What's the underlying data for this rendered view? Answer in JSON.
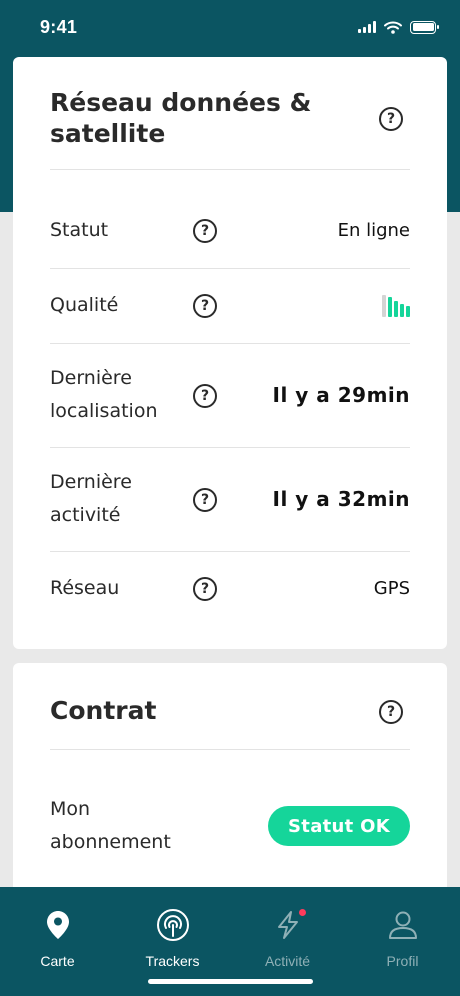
{
  "status_bar": {
    "time": "9:41"
  },
  "network_card": {
    "title": "Réseau données & satellite",
    "help_glyph": "?",
    "rows": [
      {
        "label": "Statut",
        "value": "En ligne"
      },
      {
        "label": "Qualité",
        "value": ""
      },
      {
        "label": "Dernière localisation",
        "value": "Il y a 29min"
      },
      {
        "label": "Dernière activité",
        "value": "Il y a 32min"
      },
      {
        "label": "Réseau",
        "value": "GPS"
      }
    ],
    "quality_level": 0.8,
    "quality_color": "#15d59a"
  },
  "contract_card": {
    "title": "Contrat",
    "subscription_label": "Mon abonnement",
    "status_pill": "Statut OK",
    "pill_color": "#15d59a"
  },
  "tabbar": {
    "tabs": [
      {
        "label": "Carte",
        "icon": "map-pin-icon",
        "active": true
      },
      {
        "label": "Trackers",
        "icon": "tracker-signal-icon",
        "active": true
      },
      {
        "label": "Activité",
        "icon": "lightning-icon",
        "active": false
      },
      {
        "label": "Profil",
        "icon": "user-icon",
        "active": false
      }
    ]
  },
  "colors": {
    "brand": "#0b5562",
    "accent": "#15d59a",
    "notification": "#ff3b5c"
  }
}
